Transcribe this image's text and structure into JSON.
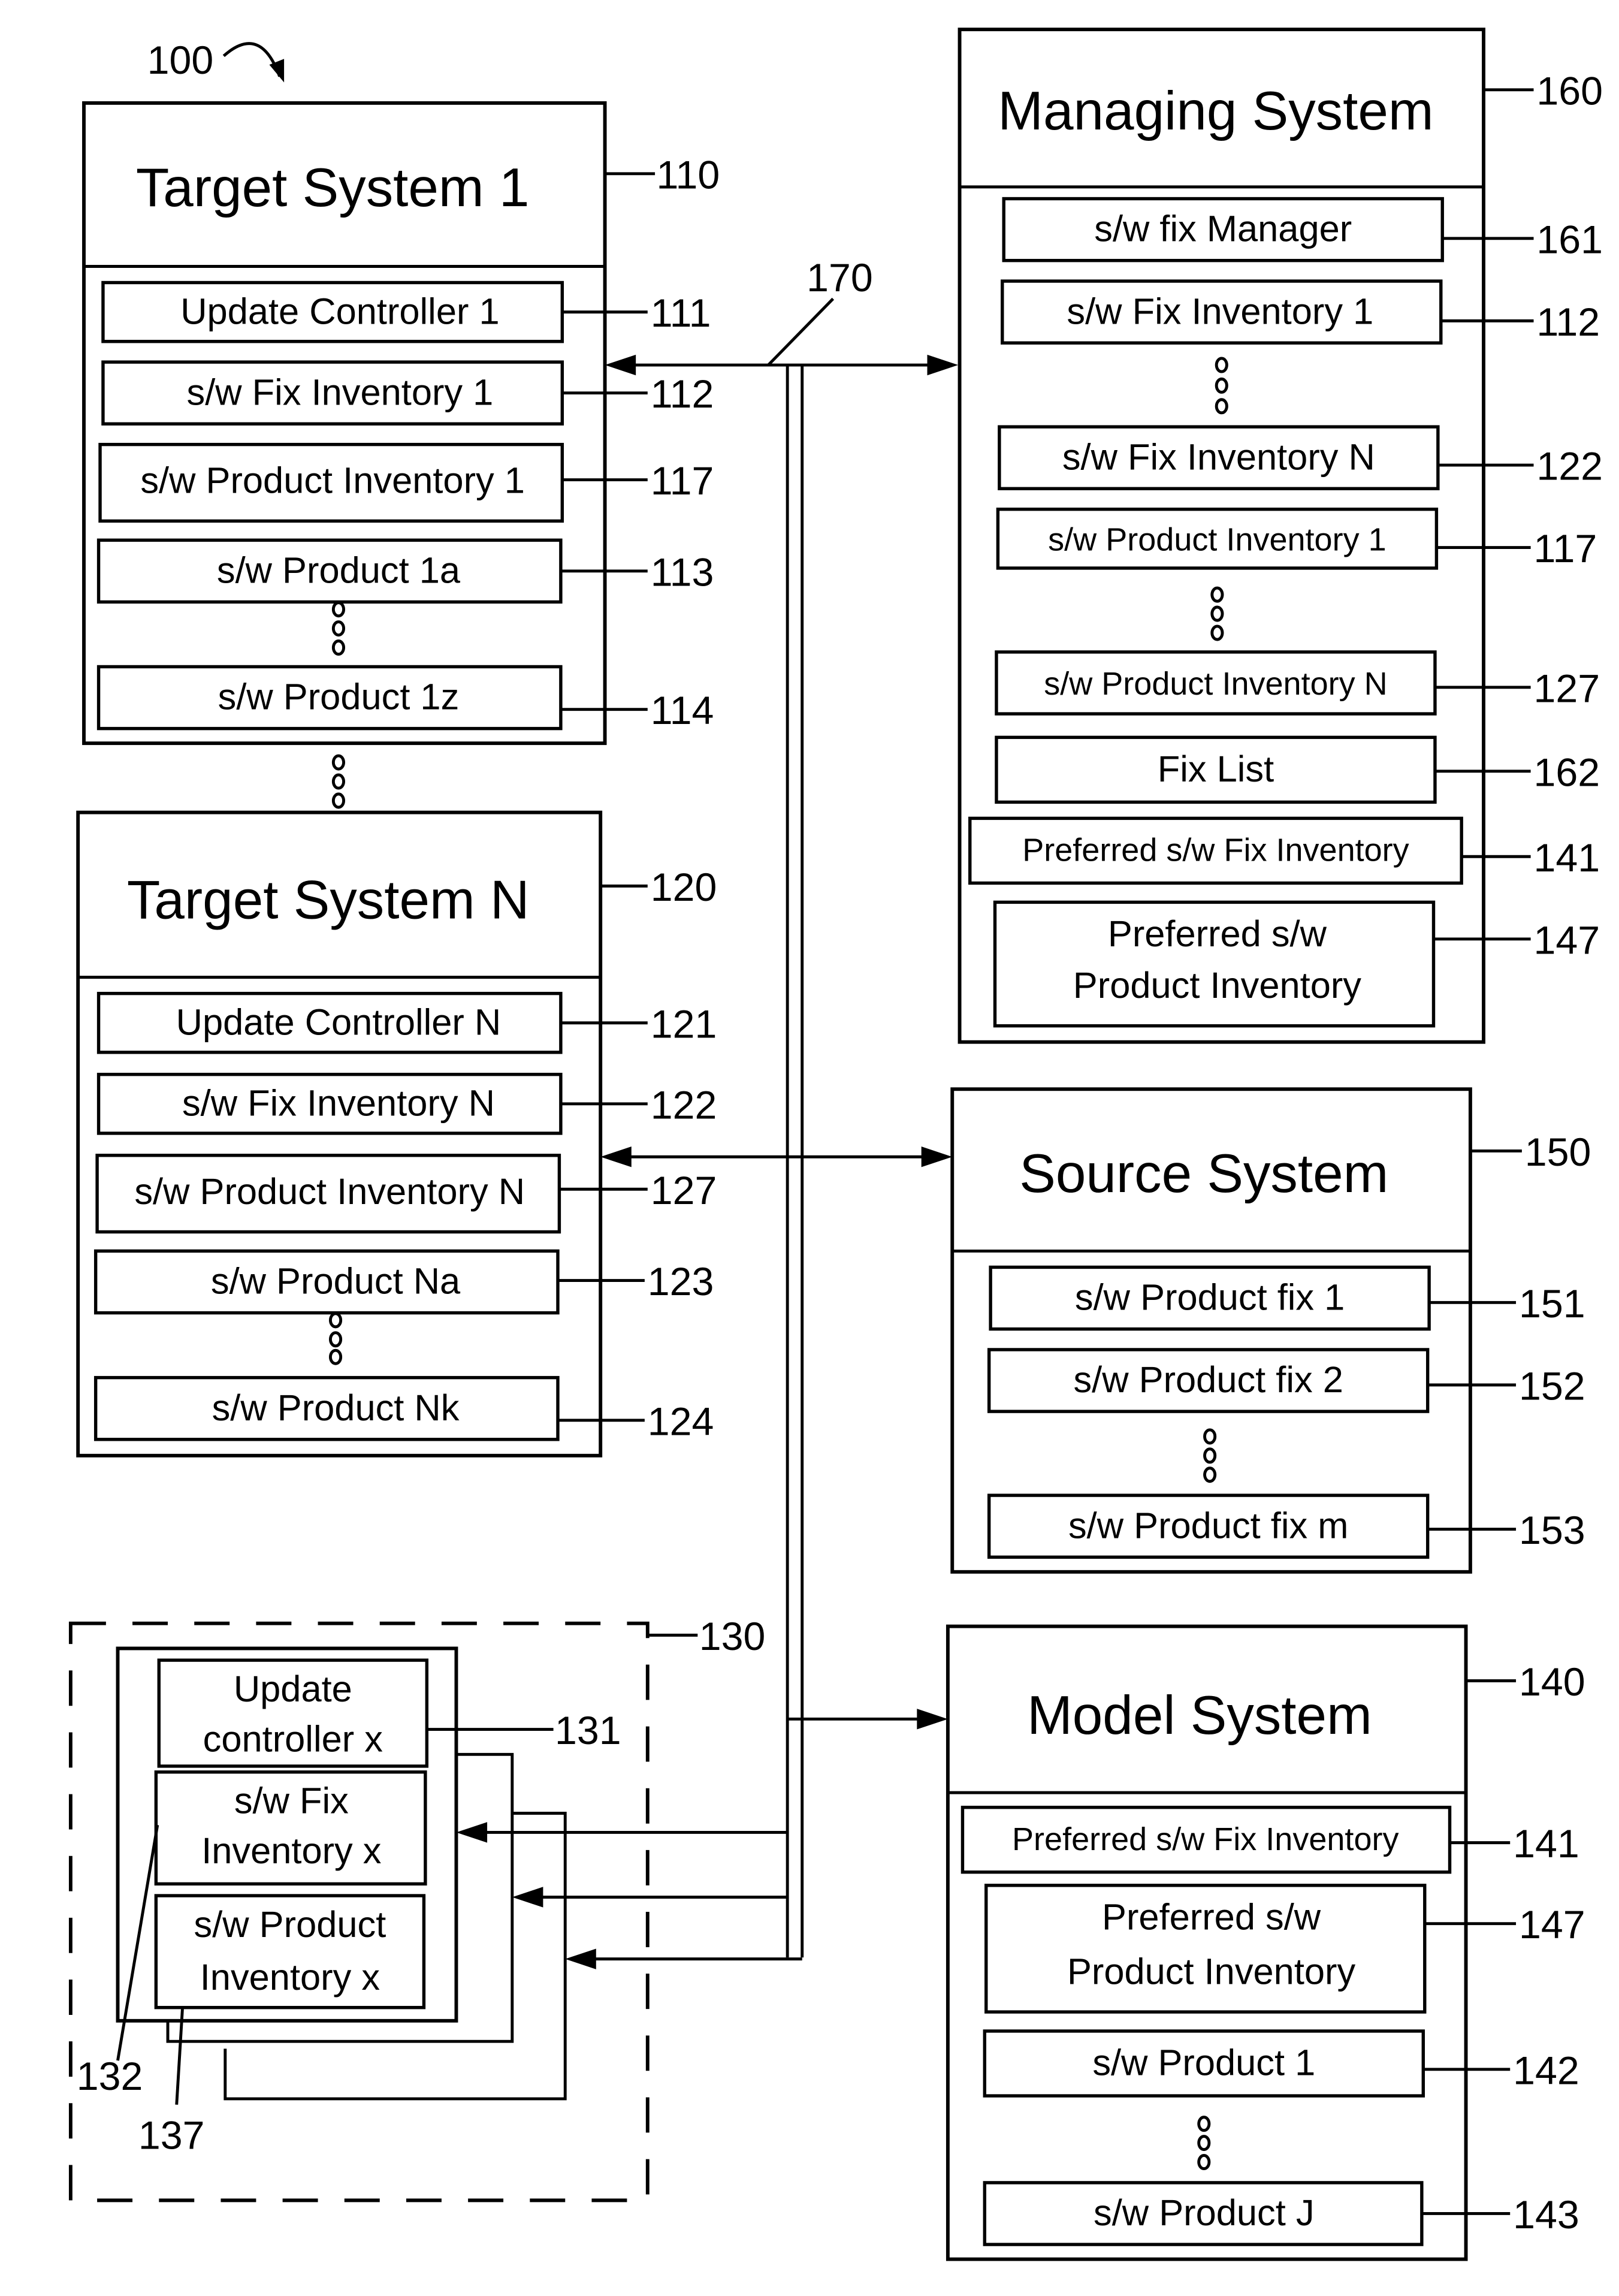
{
  "figure_ref": "100",
  "bus_ref": "170",
  "target_system_1": {
    "title": "Target System 1",
    "ref": "110",
    "items": [
      {
        "label": "Update Controller 1",
        "ref": "111"
      },
      {
        "label": "s/w Fix Inventory 1",
        "ref": "112"
      },
      {
        "label": "s/w Product Inventory 1",
        "ref": "117"
      },
      {
        "label": "s/w Product 1a",
        "ref": "113"
      },
      {
        "label": "s/w Product 1z",
        "ref": "114"
      }
    ]
  },
  "target_system_n": {
    "title": "Target System N",
    "ref": "120",
    "items": [
      {
        "label": "Update Controller N",
        "ref": "121"
      },
      {
        "label": "s/w Fix Inventory N",
        "ref": "122"
      },
      {
        "label": "s/w Product Inventory N",
        "ref": "127"
      },
      {
        "label": "s/w Product Na",
        "ref": "123"
      },
      {
        "label": "s/w Product Nk",
        "ref": "124"
      }
    ]
  },
  "group_x": {
    "ref": "130",
    "items": [
      {
        "line1": "Update",
        "line2": "controller x",
        "ref": "131"
      },
      {
        "line1": "s/w Fix",
        "line2": "Inventory x",
        "ref": "132"
      },
      {
        "line1": "s/w Product",
        "line2": "Inventory x",
        "ref": "137"
      }
    ]
  },
  "managing_system": {
    "title": "Managing System",
    "ref": "160",
    "items": [
      {
        "label": "s/w fix Manager",
        "ref": "161"
      },
      {
        "label": "s/w Fix Inventory 1",
        "ref": "112"
      },
      {
        "label": "s/w Fix Inventory N",
        "ref": "122"
      },
      {
        "label": "s/w Product Inventory 1",
        "ref": "117"
      },
      {
        "label": "s/w Product Inventory N",
        "ref": "127"
      },
      {
        "label": "Fix List",
        "ref": "162"
      },
      {
        "label": "Preferred s/w Fix Inventory",
        "ref": "141"
      },
      {
        "line1": "Preferred s/w",
        "line2": "Product Inventory",
        "ref": "147"
      }
    ]
  },
  "source_system": {
    "title": "Source System",
    "ref": "150",
    "items": [
      {
        "label": "s/w Product fix 1",
        "ref": "151"
      },
      {
        "label": "s/w Product fix 2",
        "ref": "152"
      },
      {
        "label": "s/w Product fix m",
        "ref": "153"
      }
    ]
  },
  "model_system": {
    "title": "Model System",
    "ref": "140",
    "items": [
      {
        "label": "Preferred s/w Fix Inventory",
        "ref": "141"
      },
      {
        "line1": "Preferred s/w",
        "line2": "Product Inventory",
        "ref": "147"
      },
      {
        "label": "s/w Product 1",
        "ref": "142"
      },
      {
        "label": "s/w Product J",
        "ref": "143"
      }
    ]
  }
}
